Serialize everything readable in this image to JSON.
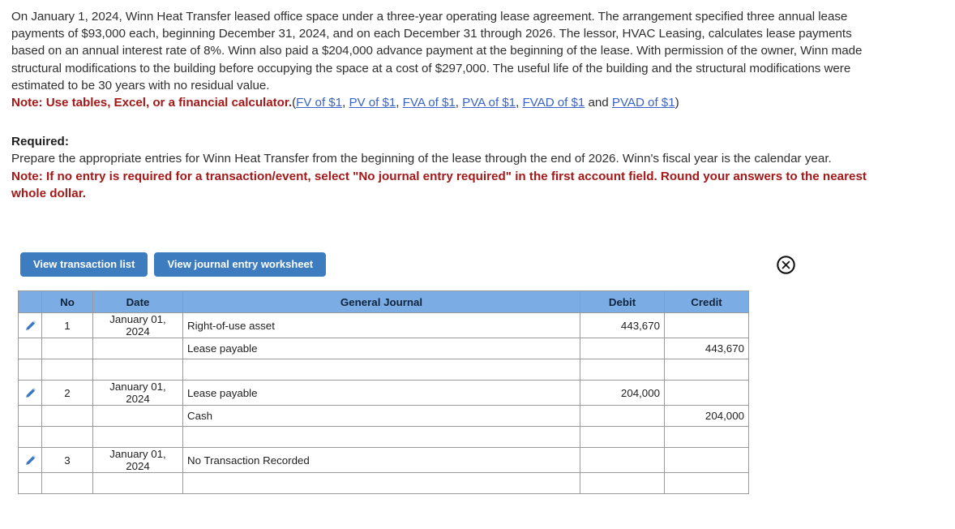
{
  "problem": {
    "paragraph": "On January 1, 2024, Winn Heat Transfer leased office space under a three-year operating lease agreement. The arrangement specified three annual lease payments of $93,000 each, beginning December 31, 2024, and on each December 31 through 2026. The lessor, HVAC Leasing, calculates lease payments based on an annual interest rate of 8%. Winn also paid a $204,000 advance payment at the beginning of the lease. With permission of the owner, Winn made structural modifications to the building before occupying the space at a cost of $297,000. The useful life of the building and the structural modifications were estimated to be 30 years with no residual value.",
    "note_label": "Note: Use tables, Excel, or a financial calculator.",
    "paren_open": "(",
    "links": [
      {
        "label": "FV of $1",
        "sep": ", "
      },
      {
        "label": "PV of $1",
        "sep": ", "
      },
      {
        "label": "FVA of $1",
        "sep": ", "
      },
      {
        "label": "PVA of $1",
        "sep": ", "
      },
      {
        "label": "FVAD of $1",
        "sep": " and "
      },
      {
        "label": "PVAD of $1",
        "sep": ""
      }
    ],
    "paren_close": ")"
  },
  "required": {
    "heading": "Required:",
    "body": "Prepare the appropriate entries for Winn Heat Transfer from the beginning of the lease through the end of 2026. Winn's fiscal year is the calendar year.",
    "note": "Note: If no entry is required for a transaction/event, select \"No journal entry required\" in the first account field. Round your answers to the nearest whole dollar."
  },
  "toolbar": {
    "transaction_list_label": "View transaction list",
    "journal_worksheet_label": "View journal entry worksheet",
    "close_icon": "close-circle-icon"
  },
  "journal": {
    "columns": [
      "No",
      "Date",
      "General Journal",
      "Debit",
      "Credit"
    ],
    "edit_icon": "pencil-edit-icon",
    "rows": [
      {
        "edit": true,
        "no": "1",
        "date": "January 01, 2024",
        "account": "Right-of-use asset",
        "indent": false,
        "debit": "443,670",
        "credit": ""
      },
      {
        "edit": false,
        "no": "",
        "date": "",
        "account": "Lease payable",
        "indent": true,
        "debit": "",
        "credit": "443,670"
      },
      {
        "edit": false,
        "no": "",
        "date": "",
        "account": "",
        "indent": false,
        "debit": "",
        "credit": ""
      },
      {
        "edit": true,
        "no": "2",
        "date": "January 01, 2024",
        "account": "Lease payable",
        "indent": false,
        "debit": "204,000",
        "credit": ""
      },
      {
        "edit": false,
        "no": "",
        "date": "",
        "account": "Cash",
        "indent": true,
        "debit": "",
        "credit": "204,000"
      },
      {
        "edit": false,
        "no": "",
        "date": "",
        "account": "",
        "indent": false,
        "debit": "",
        "credit": ""
      },
      {
        "edit": true,
        "no": "3",
        "date": "January 01, 2024",
        "account": "No Transaction Recorded",
        "indent": false,
        "debit": "",
        "credit": ""
      },
      {
        "edit": false,
        "no": "",
        "date": "",
        "account": "",
        "indent": false,
        "debit": "",
        "credit": ""
      }
    ]
  },
  "colors": {
    "header_blue": "#7bace4",
    "button_blue": "#3d7cbe",
    "note_red": "#a31919",
    "link_blue": "#3a63c8",
    "grid_gray": "#9a9a9a"
  }
}
